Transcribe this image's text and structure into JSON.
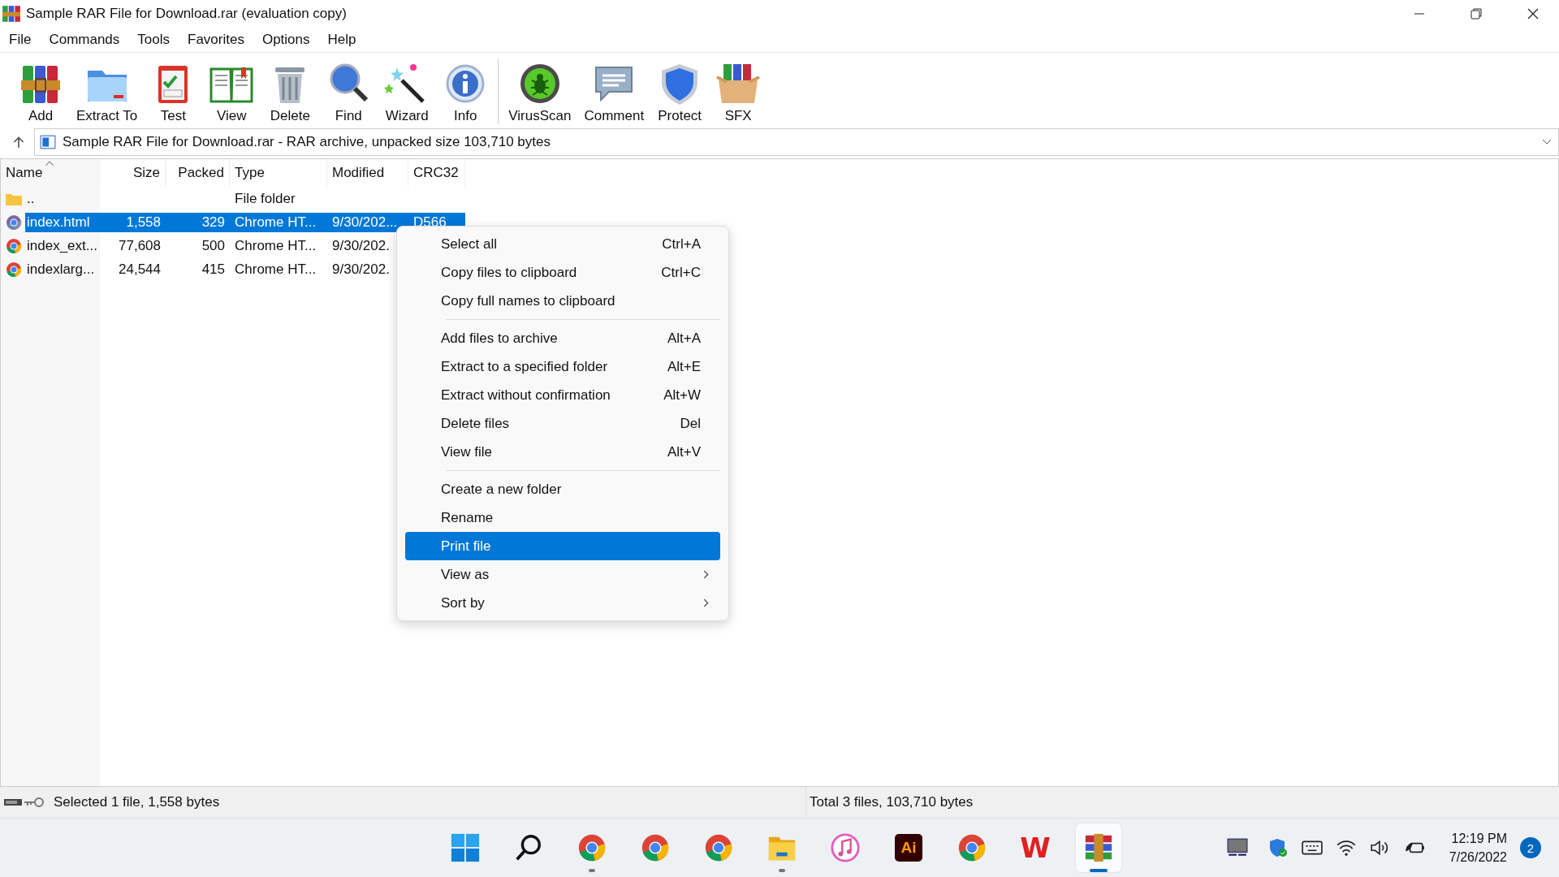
{
  "window": {
    "title": "Sample RAR File for Download.rar (evaluation copy)"
  },
  "menu_bar": [
    "File",
    "Commands",
    "Tools",
    "Favorites",
    "Options",
    "Help"
  ],
  "toolbar": [
    {
      "kind": "add",
      "label": "Add"
    },
    {
      "kind": "extract",
      "label": "Extract To"
    },
    {
      "kind": "test",
      "label": "Test"
    },
    {
      "kind": "view",
      "label": "View"
    },
    {
      "kind": "delete",
      "label": "Delete"
    },
    {
      "kind": "find",
      "label": "Find"
    },
    {
      "kind": "wizard",
      "label": "Wizard"
    },
    {
      "kind": "info",
      "label": "Info"
    },
    {
      "kind": "separator"
    },
    {
      "kind": "virus",
      "label": "VirusScan"
    },
    {
      "kind": "comment",
      "label": "Comment"
    },
    {
      "kind": "protect",
      "label": "Protect"
    },
    {
      "kind": "sfx",
      "label": "SFX"
    }
  ],
  "address": {
    "text": "Sample RAR File for Download.rar - RAR archive, unpacked size 103,710 bytes"
  },
  "table": {
    "columns": [
      {
        "label": "Name",
        "sorted": true
      },
      {
        "label": "Size",
        "sorted": false
      },
      {
        "label": "Packed",
        "sorted": false
      },
      {
        "label": "Type",
        "sorted": false
      },
      {
        "label": "Modified",
        "sorted": false
      },
      {
        "label": "CRC32",
        "sorted": false
      }
    ],
    "rows": [
      {
        "kind": "folder",
        "cells": [
          "..",
          "",
          "",
          "File folder",
          "",
          ""
        ],
        "selected": false
      },
      {
        "kind": "page",
        "cells": [
          "index.html",
          "1,558",
          "329",
          "Chrome HT...",
          "9/30/202...",
          "D566"
        ],
        "selected": true
      },
      {
        "kind": "page",
        "cells": [
          "index_ext...",
          "77,608",
          "500",
          "Chrome HT...",
          "9/30/202.",
          ""
        ],
        "selected": false
      },
      {
        "kind": "page",
        "cells": [
          "indexlarg...",
          "24,544",
          "415",
          "Chrome HT...",
          "9/30/202.",
          ""
        ],
        "selected": false
      }
    ]
  },
  "context_menu": [
    {
      "kind": "item",
      "label": "Select all",
      "shortcut": "Ctrl+A",
      "selected": false
    },
    {
      "kind": "item",
      "label": "Copy files to clipboard",
      "shortcut": "Ctrl+C",
      "selected": false
    },
    {
      "kind": "item",
      "label": "Copy full names to clipboard",
      "selected": false
    },
    {
      "kind": "separator"
    },
    {
      "kind": "item",
      "label": "Add files to archive",
      "shortcut": "Alt+A",
      "selected": false
    },
    {
      "kind": "item",
      "label": "Extract to a specified folder",
      "shortcut": "Alt+E",
      "selected": false
    },
    {
      "kind": "item",
      "label": "Extract without confirmation",
      "shortcut": "Alt+W",
      "selected": false
    },
    {
      "kind": "item",
      "label": "Delete files",
      "shortcut": "Del",
      "selected": false
    },
    {
      "kind": "item",
      "label": "View file",
      "shortcut": "Alt+V",
      "selected": false
    },
    {
      "kind": "separator"
    },
    {
      "kind": "item",
      "label": "Create a new folder",
      "selected": false
    },
    {
      "kind": "item",
      "label": "Rename",
      "selected": false
    },
    {
      "kind": "item",
      "label": "Print file",
      "selected": true
    },
    {
      "kind": "submenu",
      "label": "View as",
      "selected": false
    },
    {
      "kind": "submenu",
      "label": "Sort by",
      "selected": false
    }
  ],
  "status_bar": {
    "left": "Selected 1 file, 1,558 bytes",
    "right": "Total 3 files, 103,710 bytes"
  },
  "taskbar": {
    "apps": [
      {
        "kind": "start",
        "running": false,
        "active": false
      },
      {
        "kind": "search",
        "running": false,
        "active": false
      },
      {
        "kind": "chrome",
        "running": true,
        "active": false
      },
      {
        "kind": "chrome",
        "running": false,
        "active": false
      },
      {
        "kind": "chrome",
        "running": false,
        "active": false
      },
      {
        "kind": "folder",
        "running": true,
        "active": false
      },
      {
        "kind": "music",
        "running": false,
        "active": false
      },
      {
        "kind": "illustrator",
        "label": "Ai",
        "running": false,
        "active": false
      },
      {
        "kind": "chrome",
        "running": false,
        "active": false
      },
      {
        "kind": "wps",
        "label": "W",
        "running": false,
        "active": false
      },
      {
        "kind": "archive",
        "running": true,
        "active": true
      }
    ],
    "time": "12:19 PM",
    "date": "7/26/2022",
    "notifications": "2"
  }
}
